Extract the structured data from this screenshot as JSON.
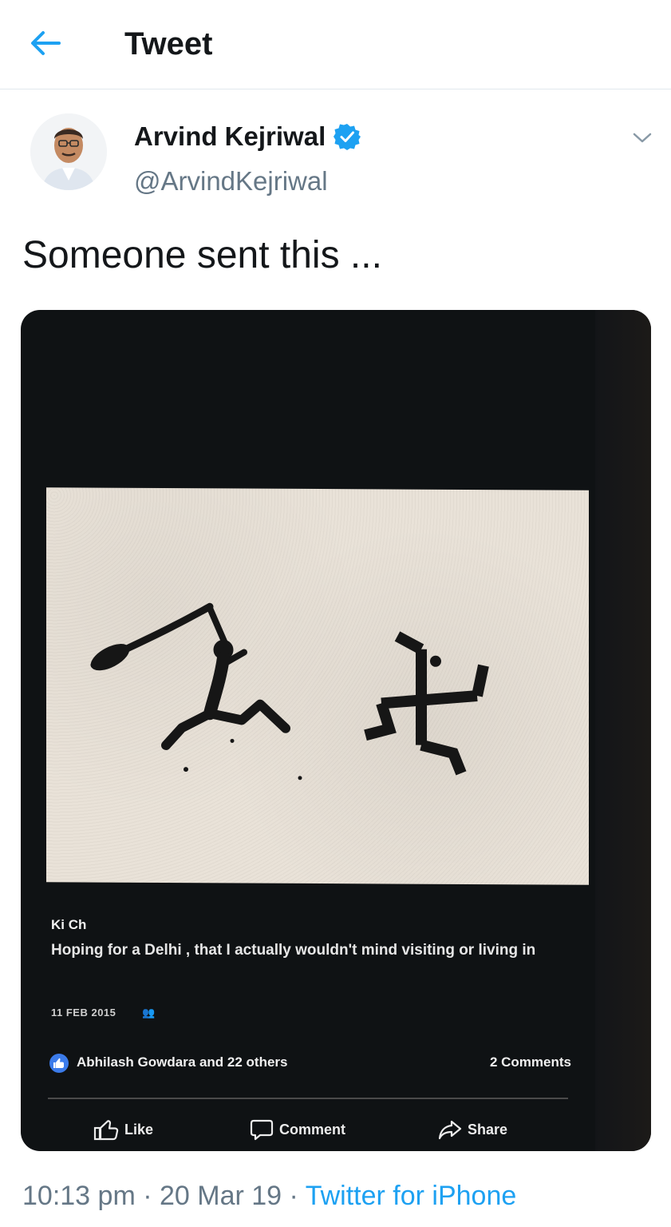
{
  "header": {
    "title": "Tweet",
    "back_icon": "arrow-left-icon",
    "accent_color": "#1da1f2"
  },
  "tweet": {
    "author_name": "Arvind Kejriwal",
    "author_handle": "@ArvindKejriwal",
    "verified": true,
    "text": "Someone sent this ...",
    "time": "10:13 pm",
    "date": "20 Mar 19",
    "separator": "·",
    "source": "Twitter for iPhone"
  },
  "media": {
    "post_author": "Ki Ch",
    "post_text": "Hoping for a Delhi  , that I actually wouldn't mind visiting or living in",
    "post_date": "11 FEB 2015",
    "likers": "Abhilash Gowdara and 22 others",
    "comments_count": "2 Comments",
    "actions": {
      "like": "Like",
      "comment": "Comment",
      "share": "Share"
    }
  }
}
